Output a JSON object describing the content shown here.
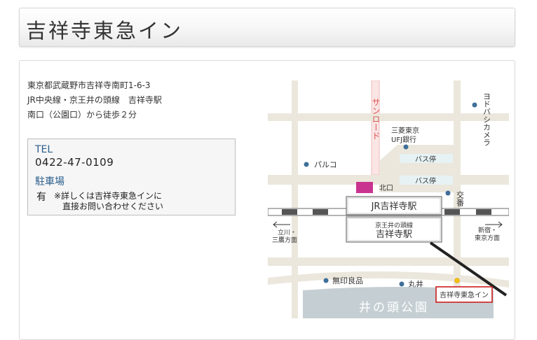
{
  "page": {
    "title": "吉祥寺東急イン"
  },
  "address": {
    "line1": "東京都武蔵野市吉祥寺南町1-6-3",
    "line2": "JR中央線・京王井の頭線　吉祥寺駅",
    "line3": "南口（公園口）から徒歩２分"
  },
  "contact": {
    "tel_label": "TEL",
    "tel_number": "0422-47-0109",
    "parking_label": "駐車場",
    "parking_value": "有",
    "parking_note_line1": "※詳しくは吉祥寺東急インに",
    "parking_note_line2": "直接お問い合わせください"
  },
  "map": {
    "sunroad": "サンロード",
    "mitsubishi_line1": "三菱東京",
    "mitsubishi_line2": "UFJ銀行",
    "yodobashi": "ヨドバシカメラ",
    "parco": "パルコ",
    "bus_stop_1": "バス停",
    "bus_stop_2": "バス停",
    "north_exit": "北口",
    "koban": "交番",
    "jr_station": "JR吉祥寺駅",
    "keio_line": "京王井の頭線",
    "keio_station": "吉祥寺駅",
    "tachikawa_line1": "立川・",
    "tachikawa_line2": "三鷹方面",
    "shinjuku_line1": "新宿・",
    "shinjuku_line2": "東京方面",
    "muji": "無印良品",
    "marui": "丸井",
    "hotel": "吉祥寺東急イン",
    "park": "井の頭公園"
  },
  "colors": {
    "road": "#ebe7dc",
    "map_bg": "#ffffff",
    "highlight": "#c8348f",
    "hotel_border": "#cc1d1d",
    "poi_dot": "#3f6f9a",
    "hotel_dot": "#f2c10f",
    "park": "#c5cfd3",
    "label_blue": "#2a5d8b"
  }
}
